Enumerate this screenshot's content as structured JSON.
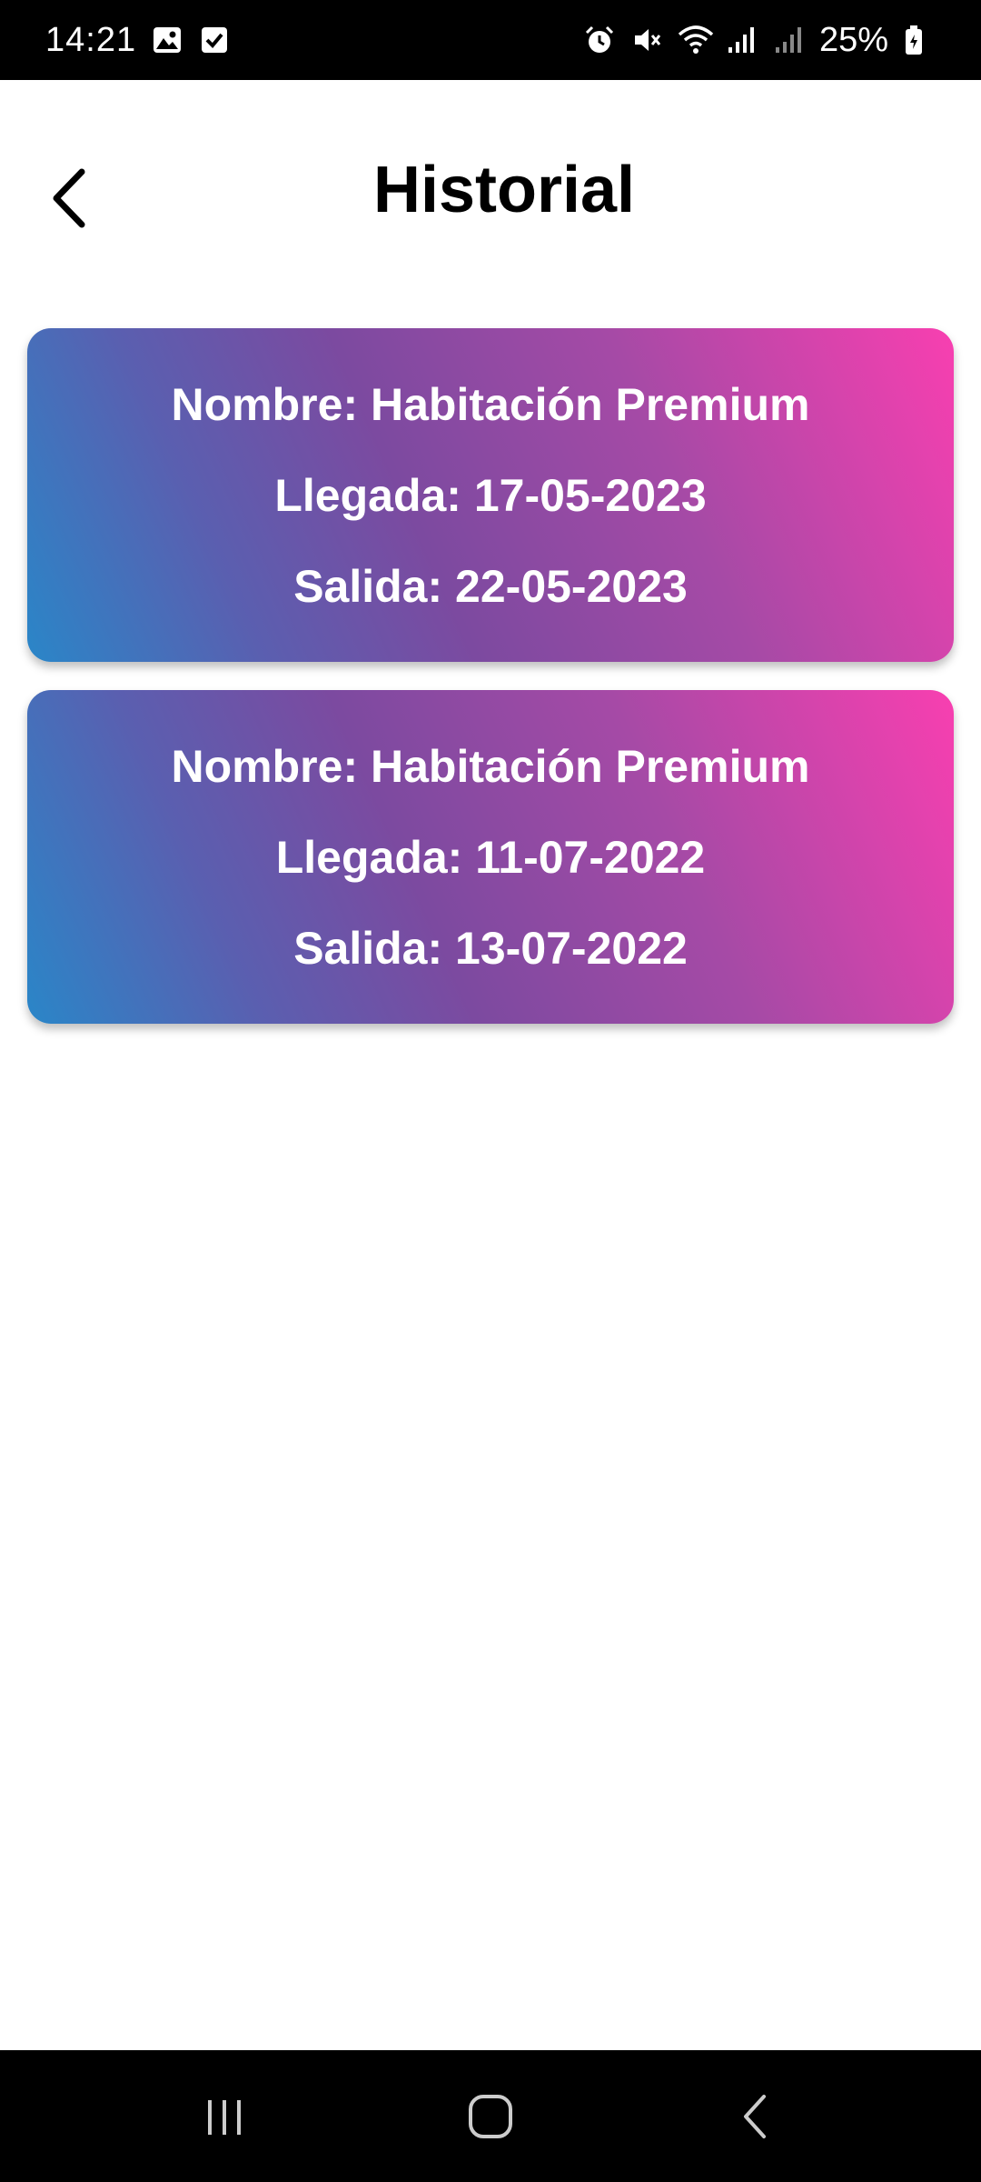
{
  "status_bar": {
    "time": "14:21",
    "left_icons": [
      "gallery-icon",
      "checkbox-icon"
    ],
    "right_icons": [
      "alarm-icon",
      "mute-icon",
      "wifi-icon",
      "signal-icon",
      "signal-icon-2"
    ],
    "battery": "25%"
  },
  "header": {
    "title": "Historial",
    "back_icon": "chevron-left-icon"
  },
  "history": [
    {
      "name_label": "Nombre:",
      "name_value": "Habitación Premium",
      "arrival_label": "Llegada:",
      "arrival_value": "17-05-2023",
      "departure_label": "Salida:",
      "departure_value": "22-05-2023"
    },
    {
      "name_label": "Nombre:",
      "name_value": "Habitación Premium",
      "arrival_label": "Llegada:",
      "arrival_value": "11-07-2022",
      "departure_label": "Salida:",
      "departure_value": "13-07-2022"
    }
  ],
  "nav_bar": {
    "recents_icon": "recents-icon",
    "home_icon": "home-icon",
    "back_icon": "back-icon"
  },
  "colors": {
    "gradient_start": "#2a86c8",
    "gradient_end": "#f83fb0",
    "bars": "#000000"
  }
}
